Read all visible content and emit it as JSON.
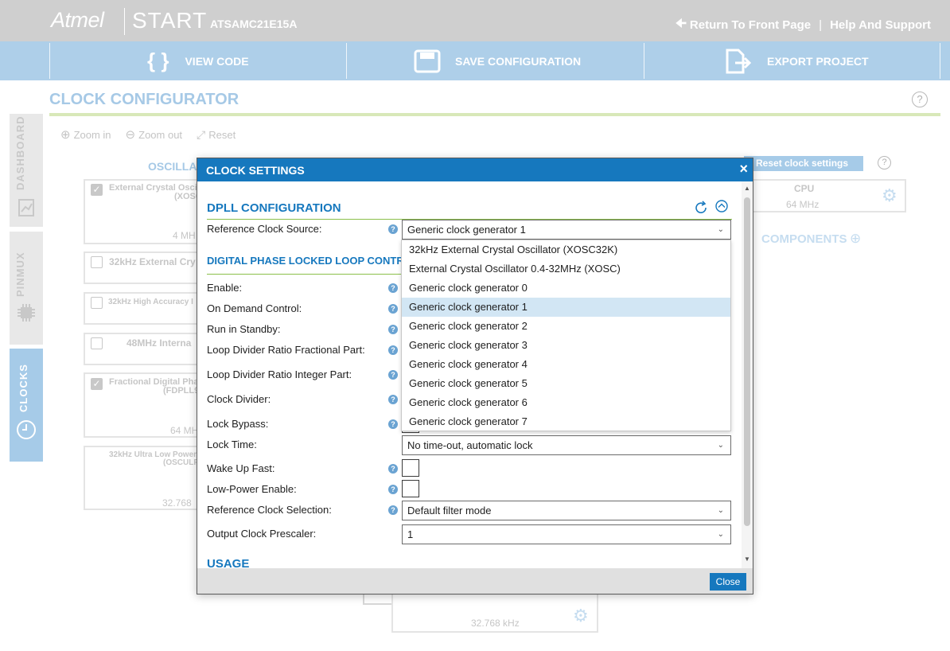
{
  "header": {
    "logo": "Atmel",
    "product": "START",
    "device": "ATSAMC21E15A",
    "return_link": "Return To Front Page",
    "separator": "|",
    "help_link": "Help And Support"
  },
  "toolbar": {
    "view_code": "VIEW CODE",
    "save_configuration": "SAVE CONFIGURATION",
    "export_project": "EXPORT PROJECT"
  },
  "page": {
    "title": "CLOCK CONFIGURATOR",
    "help_glyph": "?"
  },
  "sidebar": {
    "tabs": [
      {
        "label": "DASHBOARD",
        "active": false
      },
      {
        "label": "PINMUX",
        "active": false
      },
      {
        "label": "CLOCKS",
        "active": true
      }
    ]
  },
  "zoom": {
    "zoom_in": "Zoom in",
    "zoom_out": "Zoom out",
    "reset": "Reset"
  },
  "background": {
    "oscillators_heading": "OSCILLA",
    "reset_clock_settings": "Reset clock settings",
    "components_heading": "COMPONENTS",
    "boxes": [
      {
        "label": "External Crystal Osci",
        "sub": "(XOSC",
        "freq": "4 MH",
        "checked": true
      },
      {
        "label": "32kHz External Cry",
        "checked": false
      },
      {
        "label": "32kHz High Accuracy I",
        "checked": false
      },
      {
        "label": "48MHz Interna",
        "checked": false
      },
      {
        "label": "Fractional Digital Pha",
        "sub": "(FDPLL9",
        "freq": "64 MH",
        "checked": true
      },
      {
        "label": "32kHz Ultra Low Power",
        "sub": "(OSCULP",
        "freq": "32.768"
      }
    ],
    "cpu": {
      "label": "CPU",
      "freq": "64 MHz"
    },
    "bottom_freq": "32.768 kHz"
  },
  "dialog": {
    "title": "CLOCK SETTINGS",
    "close_x": "×",
    "close_button": "Close",
    "section_dpll": "DPLL CONFIGURATION",
    "section_digital": "DIGITAL PHASE LOCKED LOOP CONTRO",
    "section_usage": "USAGE",
    "reference_clock_source": {
      "label": "Reference Clock Source:",
      "value": "Generic clock generator 1"
    },
    "fields": [
      {
        "label": "Enable:"
      },
      {
        "label": "On Demand Control:"
      },
      {
        "label": "Run in Standby:"
      },
      {
        "label": "Loop Divider Ratio Fractional Part:"
      },
      {
        "label": "Loop Divider Ratio Integer Part:"
      },
      {
        "label": "Clock Divider:"
      },
      {
        "label": "Lock Bypass:"
      }
    ],
    "lock_time": {
      "label": "Lock Time:",
      "value": "No time-out, automatic lock"
    },
    "wake_up_fast": {
      "label": "Wake Up Fast:",
      "checked": false
    },
    "low_power_enable": {
      "label": "Low-Power Enable:",
      "checked": false
    },
    "reference_clock_selection": {
      "label": "Reference Clock Selection:",
      "value": "Default filter mode"
    },
    "output_clock_prescaler": {
      "label": "Output Clock Prescaler:",
      "value": "1"
    },
    "help_glyph": "?"
  },
  "dropdown": {
    "options": [
      "32kHz External Crystal Oscillator (XOSC32K)",
      "External Crystal Oscillator 0.4-32MHz (XOSC)",
      "Generic clock generator 0",
      "Generic clock generator 1",
      "Generic clock generator 2",
      "Generic clock generator 3",
      "Generic clock generator 4",
      "Generic clock generator 5",
      "Generic clock generator 6",
      "Generic clock generator 7"
    ],
    "selected_index": 3
  },
  "colors": {
    "accent": "#1678be",
    "toolbar": "#aecfe9",
    "topbar": "#cfcfcf",
    "section_line": "#8bbf4a",
    "dropdown_selected": "#d2e6f4"
  }
}
